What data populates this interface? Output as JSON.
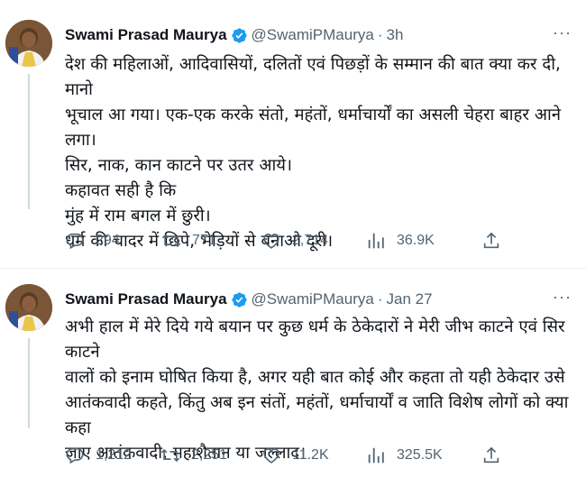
{
  "tweets": [
    {
      "author_name": "Swami Prasad Maurya",
      "handle": "@SwamiPMaurya",
      "separator": "·",
      "time": "3h",
      "more": "···",
      "lines": [
        "देश की महिलाओं, आदिवासियों, दलितों एवं पिछड़ों के सम्मान की बात क्या कर दी, मानो",
        "भूचाल आ गया। एक-एक करके संतो, महंतों, धर्माचार्यों का असली चेहरा बाहर आने लगा।",
        "सिर, नाक, कान काटने पर उतर आये।",
        "कहावत सही है कि",
        "मुंह में राम बगल में छुरी।",
        "धर्म की चादर में छिपे, भेड़ियों से बनाओ दूरी।"
      ],
      "replies": "294",
      "retweets": "771",
      "likes": "2,714",
      "views": "36.9K"
    },
    {
      "author_name": "Swami Prasad Maurya",
      "handle": "@SwamiPMaurya",
      "separator": "·",
      "time": "Jan 27",
      "more": "···",
      "lines": [
        "अभी हाल में मेरे दिये गये बयान पर कुछ धर्म के ठेकेदारों ने मेरी जीभ काटने एवं सिर काटने",
        "वालों को इनाम घोषित किया है, अगर यही बात कोई और कहता तो यही ठेकेदार उसे",
        "आतंकवादी कहते, किंतु अब इन संतों, महंतों, धर्माचार्यों व जाति विशेष लोगों को क्या कहा",
        "जाए आतंकवादी, महाशैतान या जल्लाद।"
      ],
      "replies": "1,212",
      "retweets": "2,251",
      "likes": "11.2K",
      "views": "325.5K"
    }
  ],
  "colors": {
    "verified": "#1d9bf0",
    "muted": "#536471",
    "text": "#0f1419"
  },
  "icons": [
    "verified-badge-icon",
    "reply-icon",
    "retweet-icon",
    "like-icon",
    "views-icon",
    "share-icon",
    "more-icon"
  ]
}
